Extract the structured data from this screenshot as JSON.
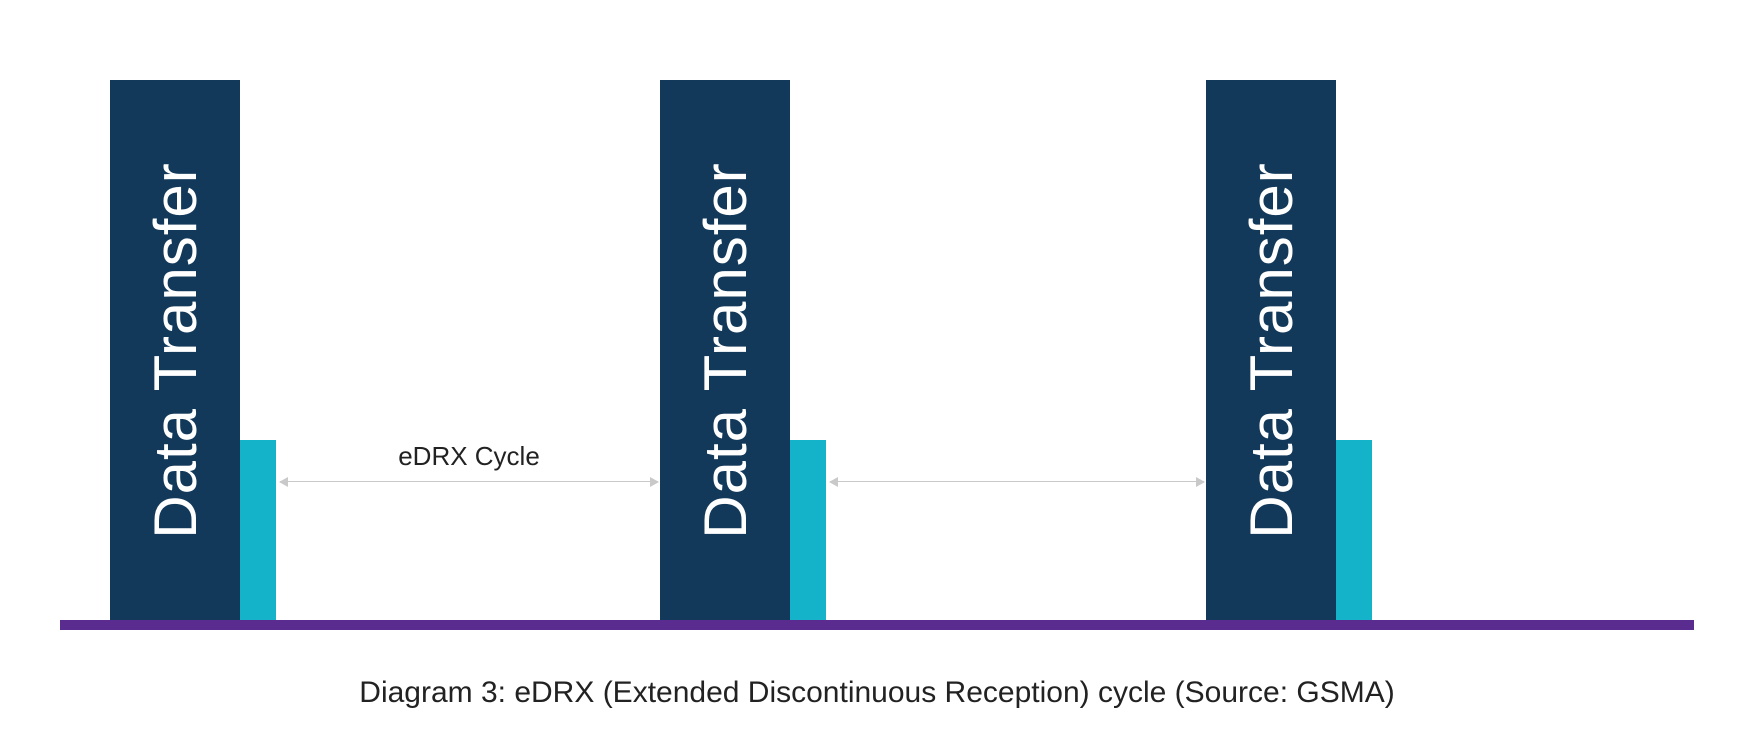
{
  "diagram": {
    "bars": [
      {
        "label": "Data Transfer"
      },
      {
        "label": "Data Transfer"
      },
      {
        "label": "Data Transfer"
      }
    ],
    "cycle_label": "eDRX Cycle",
    "caption": "Diagram 3: eDRX (Extended Discontinuous Reception) cycle (Source: GSMA)"
  },
  "colors": {
    "tall_bar": "#13395a",
    "short_bar": "#14b3c9",
    "baseline": "#5b2c8f",
    "arrow": "#c9c9c9"
  }
}
